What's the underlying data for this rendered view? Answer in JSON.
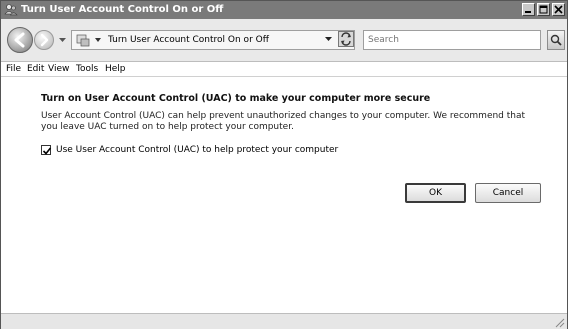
{
  "window": {
    "title": "Turn User Account Control On or Off"
  },
  "address_bar": {
    "path": "Turn User Account Control On or Off",
    "search_placeholder": "Search"
  },
  "menu": {
    "items": [
      "File",
      "Edit",
      "View",
      "Tools",
      "Help"
    ]
  },
  "content": {
    "heading": "Turn on User Account Control (UAC) to make your computer more secure",
    "description": "User Account Control (UAC) can help prevent unauthorized changes to your computer.  We recommend that you leave UAC turned on to help protect your computer.",
    "checkbox_label": "Use User Account Control (UAC) to help protect your computer",
    "checkbox_checked": true,
    "ok_label": "OK",
    "cancel_label": "Cancel"
  },
  "icons": {
    "app": "users-shield-icon",
    "back": "back-arrow-icon",
    "forward": "forward-arrow-icon",
    "refresh": "refresh-icon",
    "search": "magnifier-icon"
  }
}
